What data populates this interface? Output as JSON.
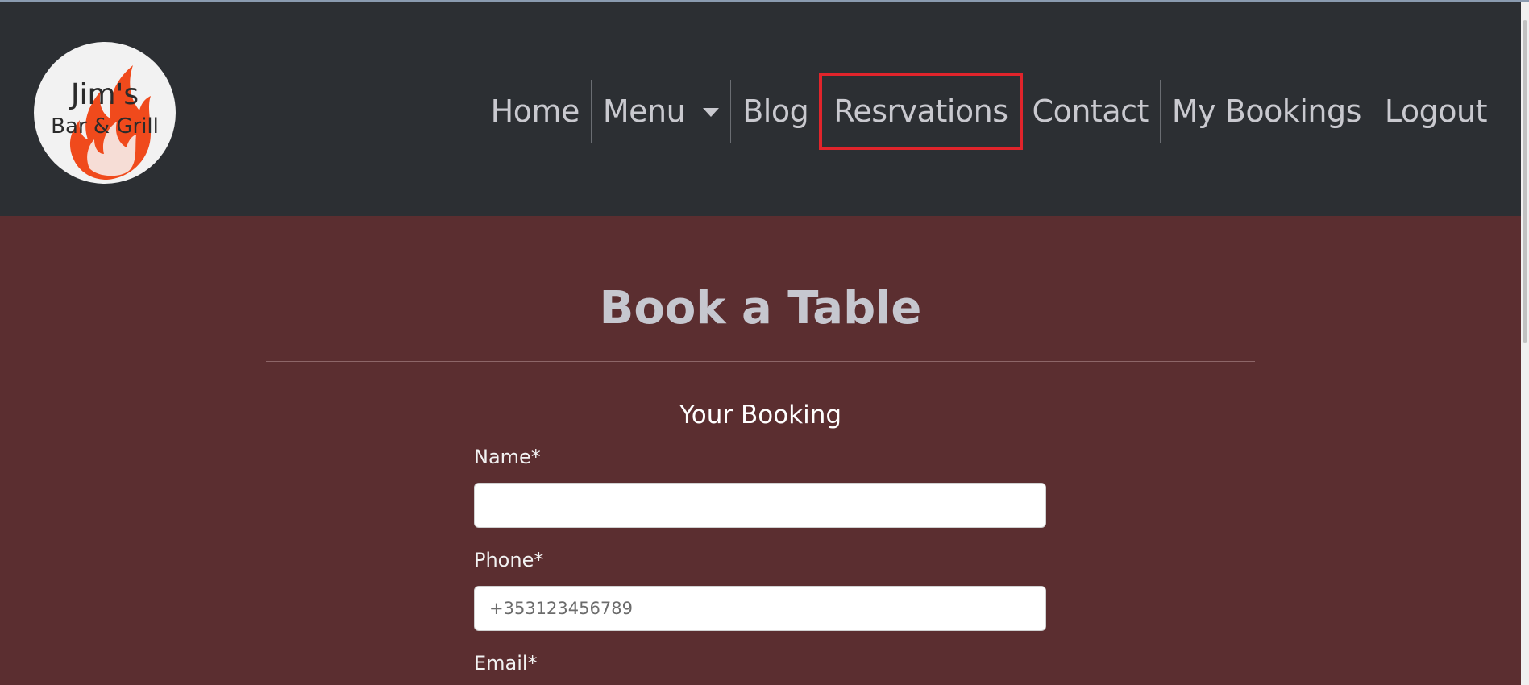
{
  "brand": {
    "logo_line1": "Jim's",
    "logo_line2": "Bar & Grill",
    "colors": {
      "flame": "#f04a1c",
      "circle": "#f2f2f2",
      "text": "#2b2b2b"
    }
  },
  "nav": {
    "items": [
      {
        "label": "Home"
      },
      {
        "label": "Menu"
      },
      {
        "label": "Blog"
      },
      {
        "label": "Resrvations"
      },
      {
        "label": "Contact"
      },
      {
        "label": "My Bookings"
      },
      {
        "label": "Logout"
      }
    ],
    "highlight_color": "#e1242b"
  },
  "page": {
    "title": "Book a Table",
    "form_title": "Your Booking",
    "fields": {
      "name": {
        "label": "Name*",
        "value": "",
        "placeholder": ""
      },
      "phone": {
        "label": "Phone*",
        "value": "",
        "placeholder": "+353123456789"
      },
      "email": {
        "label": "Email*"
      }
    }
  },
  "colors": {
    "navbar_bg": "#2c2f33",
    "page_bg": "#5b2e30",
    "nav_text": "#c9c9cf"
  }
}
